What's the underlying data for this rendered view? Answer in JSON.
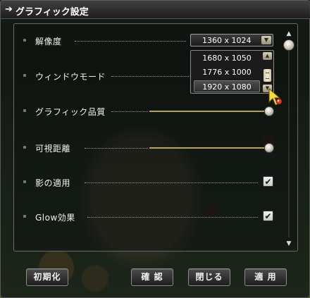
{
  "window": {
    "title_icon": "➔",
    "title": "グラフィック設定"
  },
  "settings": {
    "resolution": {
      "label": "解像度",
      "value": "1360 x 1024",
      "options": [
        "1680 x 1050",
        "1776 x 1000",
        "1920 x 1080"
      ],
      "highlighted_option": "1920 x 1080"
    },
    "window_mode": {
      "label": "ウィンドウモード"
    },
    "graphic_quality": {
      "label": "グラフィック品質",
      "level": 1.0
    },
    "view_distance": {
      "label": "可視距離",
      "level": 1.0
    },
    "shadow": {
      "label": "影の適用",
      "checked": true,
      "check_mark": "✔"
    },
    "glow": {
      "label": "Glow効果",
      "checked": true,
      "check_mark": "✔"
    }
  },
  "icons": {
    "select_arrow": "▼",
    "scroll_up": "▲",
    "scroll_down": "▼"
  },
  "buttons": {
    "reset": "初期化",
    "confirm": "確 認",
    "close": "閉じる",
    "apply": "適 用"
  }
}
